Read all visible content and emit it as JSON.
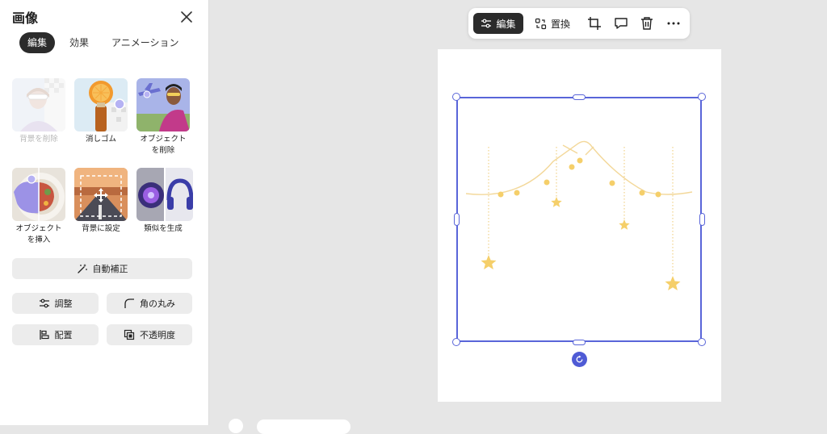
{
  "panel": {
    "title": "画像",
    "tabs": [
      {
        "label": "編集",
        "active": true
      },
      {
        "label": "効果",
        "active": false
      },
      {
        "label": "アニメーション",
        "active": false
      }
    ],
    "tools": [
      {
        "label": "背景を削除",
        "disabled": true
      },
      {
        "label": "消しゴム",
        "disabled": false
      },
      {
        "label": "オブジェクト\nを削除",
        "disabled": false
      },
      {
        "label": "オブジェクト\nを挿入",
        "disabled": false
      },
      {
        "label": "背景に設定",
        "disabled": false
      },
      {
        "label": "類似を生成",
        "disabled": false
      }
    ],
    "auto_enhance": "自動補正",
    "adjust": "調整",
    "round_corners": "角の丸み",
    "arrange": "配置",
    "opacity": "不透明度"
  },
  "toolbar": {
    "edit": "編集",
    "replace": "置換",
    "icons": [
      "crop-icon",
      "comment-icon",
      "trash-icon",
      "more-icon"
    ]
  },
  "colors": {
    "accent": "#5965d9",
    "star": "#f5cf6a",
    "garland": "#f3d89a",
    "dark_button": "#2b2b2b"
  }
}
